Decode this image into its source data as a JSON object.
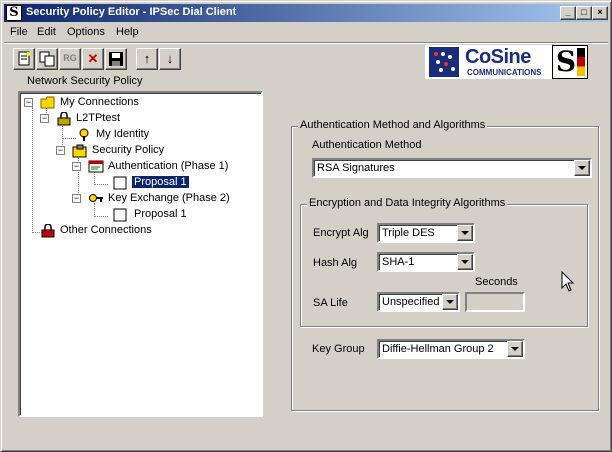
{
  "window": {
    "title": "Security Policy Editor - IPSec Dial Client",
    "app_icon_letter": "S",
    "controls": {
      "minimize": "_",
      "maximize": "□",
      "close": "×"
    }
  },
  "menu": [
    "File",
    "Edit",
    "Options",
    "Help"
  ],
  "toolbar": {
    "buttons": [
      {
        "name": "new-connection",
        "glyph": "📄",
        "enabled": true
      },
      {
        "name": "copy",
        "glyph": "⎘",
        "enabled": true
      },
      {
        "name": "rename",
        "glyph": "RG",
        "enabled": false
      },
      {
        "name": "delete",
        "glyph": "✕",
        "enabled": true
      },
      {
        "name": "save",
        "glyph": "💾",
        "enabled": true
      },
      {
        "name": "move-up",
        "glyph": "↑",
        "enabled": true
      },
      {
        "name": "move-down",
        "glyph": "↓",
        "enabled": true
      }
    ]
  },
  "logo": {
    "name": "CoSine",
    "sub": "COMMUNICATIONS",
    "secondary_letter": "S"
  },
  "tree": {
    "header": "Network Security Policy",
    "nodes": {
      "my_connections": "My Connections",
      "l2tptest": "L2TPtest",
      "my_identity": "My Identity",
      "security_policy": "Security Policy",
      "auth_phase1": "Authentication (Phase 1)",
      "auth_proposal": "Proposal 1",
      "key_exchange": "Key Exchange (Phase 2)",
      "ke_proposal": "Proposal 1",
      "other_connections": "Other Connections"
    }
  },
  "panel": {
    "group_title": "Authentication Method and Algorithms",
    "auth_method_label": "Authentication Method",
    "auth_method_value": "RSA Signatures",
    "enc_group_title": "Encryption and Data Integrity Algorithms",
    "encrypt_label": "Encrypt Alg",
    "encrypt_value": "Triple DES",
    "hash_label": "Hash Alg",
    "hash_value": "SHA-1",
    "seconds_label": "Seconds",
    "sa_life_label": "SA Life",
    "sa_life_value": "Unspecified",
    "sa_life_seconds": "",
    "key_group_label": "Key Group",
    "key_group_value": "Diffie-Hellman Group 2"
  },
  "colors": {
    "title_start": "#0a246a",
    "title_end": "#a6caf0",
    "face": "#d4d0c8",
    "selection": "#0a246a"
  }
}
